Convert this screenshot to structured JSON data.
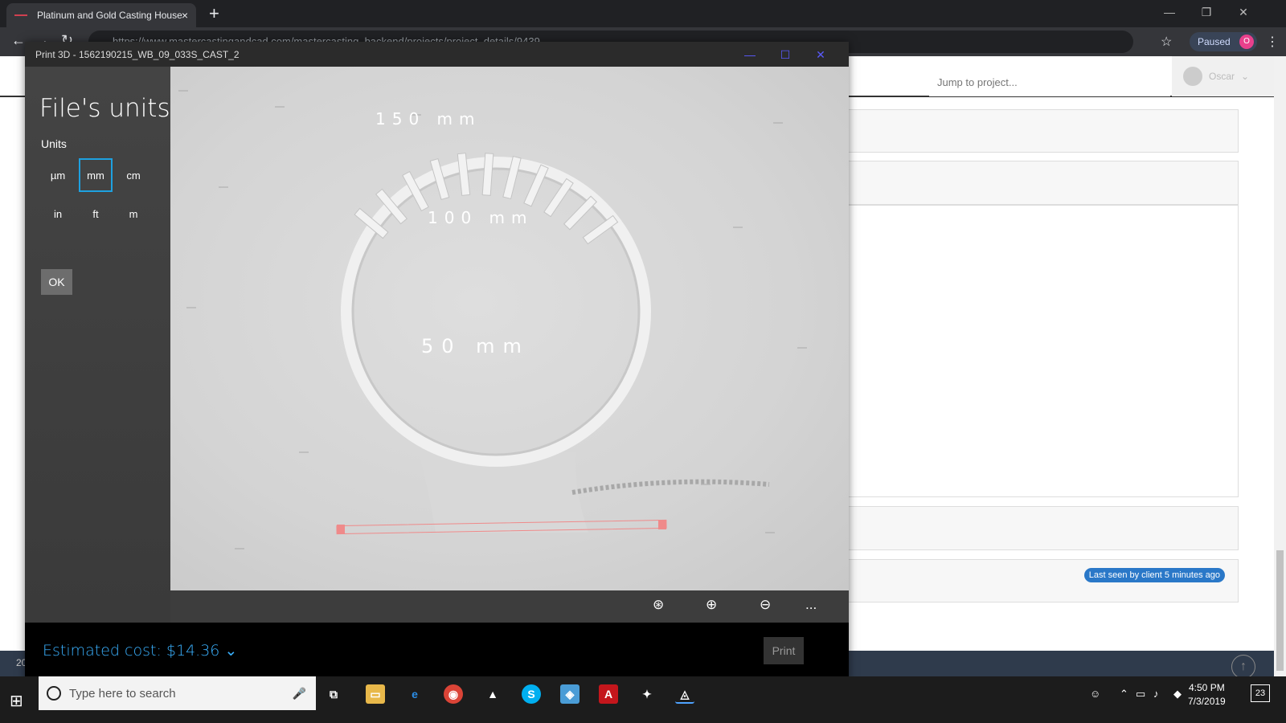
{
  "browser": {
    "tab_title": "Platinum and Gold Casting House",
    "tab_close": "×",
    "new_tab": "+",
    "url": "https://www.mastercastingandcad.com/mastercasting_backend/projects/project_details/9439",
    "paused_label": "Paused",
    "profile_initial": "O",
    "minimize": "—",
    "restore": "❐",
    "close": "✕"
  },
  "page": {
    "jump_placeholder": "Jump to project...",
    "user_name": "Oscar",
    "last_seen_badge": "Last seen by client 5 minutes ago",
    "footer_text": "20"
  },
  "print3d": {
    "window_title": "Print 3D - 1562190215_WB_09_033S_CAST_2",
    "panel_title": "File's units",
    "units_label": "Units",
    "units": [
      "µm",
      "mm",
      "cm",
      "in",
      "ft",
      "m"
    ],
    "selected_unit": "mm",
    "ok_label": "OK",
    "scale_labels": [
      "150 mm",
      "100 mm",
      "50 mm"
    ],
    "estimated_cost": "Estimated cost: $14.36",
    "print_label": "Print",
    "toolbar_more": "..."
  },
  "taskbar": {
    "search_placeholder": "Type here to search",
    "time": "4:50 PM",
    "date": "7/3/2019",
    "notification_count": "23"
  }
}
